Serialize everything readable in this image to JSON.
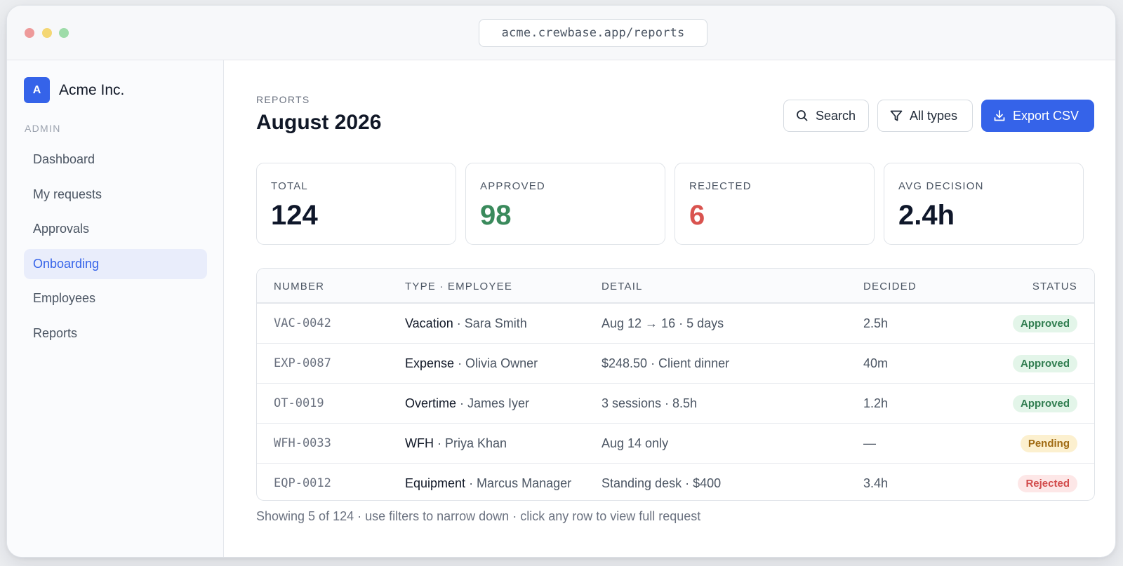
{
  "window": {
    "url": "acme.crewbase.app/reports"
  },
  "sidebar": {
    "brand_initial": "A",
    "brand_name": "Acme Inc.",
    "section_label": "ADMIN",
    "items": [
      {
        "label": "Dashboard",
        "active": false
      },
      {
        "label": "My requests",
        "active": false
      },
      {
        "label": "Approvals",
        "active": false
      },
      {
        "label": "Onboarding",
        "active": true
      },
      {
        "label": "Employees",
        "active": false
      },
      {
        "label": "Reports",
        "active": false
      }
    ]
  },
  "header": {
    "eyebrow": "REPORTS",
    "title": "August 2026",
    "search_label": "Search",
    "filter_label": "All types",
    "export_label": "Export CSV",
    "icons": {
      "search": "search-icon",
      "filter": "filter-icon",
      "export": "download-icon"
    }
  },
  "stats": [
    {
      "label": "TOTAL",
      "value": "124",
      "color": "#0f172a"
    },
    {
      "label": "APPROVED",
      "value": "98",
      "color": "#3a8a5c"
    },
    {
      "label": "REJECTED",
      "value": "6",
      "color": "#d9534f"
    },
    {
      "label": "AVG DECISION",
      "value": "2.4h",
      "color": "#0f172a"
    }
  ],
  "table": {
    "columns": [
      "NUMBER",
      "TYPE · EMPLOYEE",
      "DETAIL",
      "DECIDED",
      "STATUS"
    ],
    "rows": [
      {
        "number": "VAC-0042",
        "type": "Vacation",
        "employee": " · Sara Smith",
        "detail": "Aug 12 → 16 · 5 days",
        "decided": "2.5h",
        "status": "Approved"
      },
      {
        "number": "EXP-0087",
        "type": "Expense",
        "employee": " · Olivia Owner",
        "detail": "$248.50 · Client dinner",
        "decided": "40m",
        "status": "Approved"
      },
      {
        "number": "OT-0019",
        "type": "Overtime",
        "employee": " · James Iyer",
        "detail": "3 sessions · 8.5h",
        "decided": "1.2h",
        "status": "Approved"
      },
      {
        "number": "WFH-0033",
        "type": "WFH",
        "employee": " · Priya Khan",
        "detail": "Aug 14 only",
        "decided": "—",
        "status": "Pending"
      },
      {
        "number": "EQP-0012",
        "type": "Equipment",
        "employee": " · Marcus Manager",
        "detail": "Standing desk · $400",
        "decided": "3.4h",
        "status": "Rejected"
      }
    ]
  },
  "status_colors": {
    "Approved": {
      "bg": "#e3f5e9",
      "fg": "#2f7d4f"
    },
    "Pending": {
      "bg": "#fcf0cf",
      "fg": "#a06a12"
    },
    "Rejected": {
      "bg": "#fde7e7",
      "fg": "#d24b4b"
    }
  },
  "footer": {
    "note": "Showing 5 of 124 · use filters to narrow down · click any row to view full request"
  }
}
